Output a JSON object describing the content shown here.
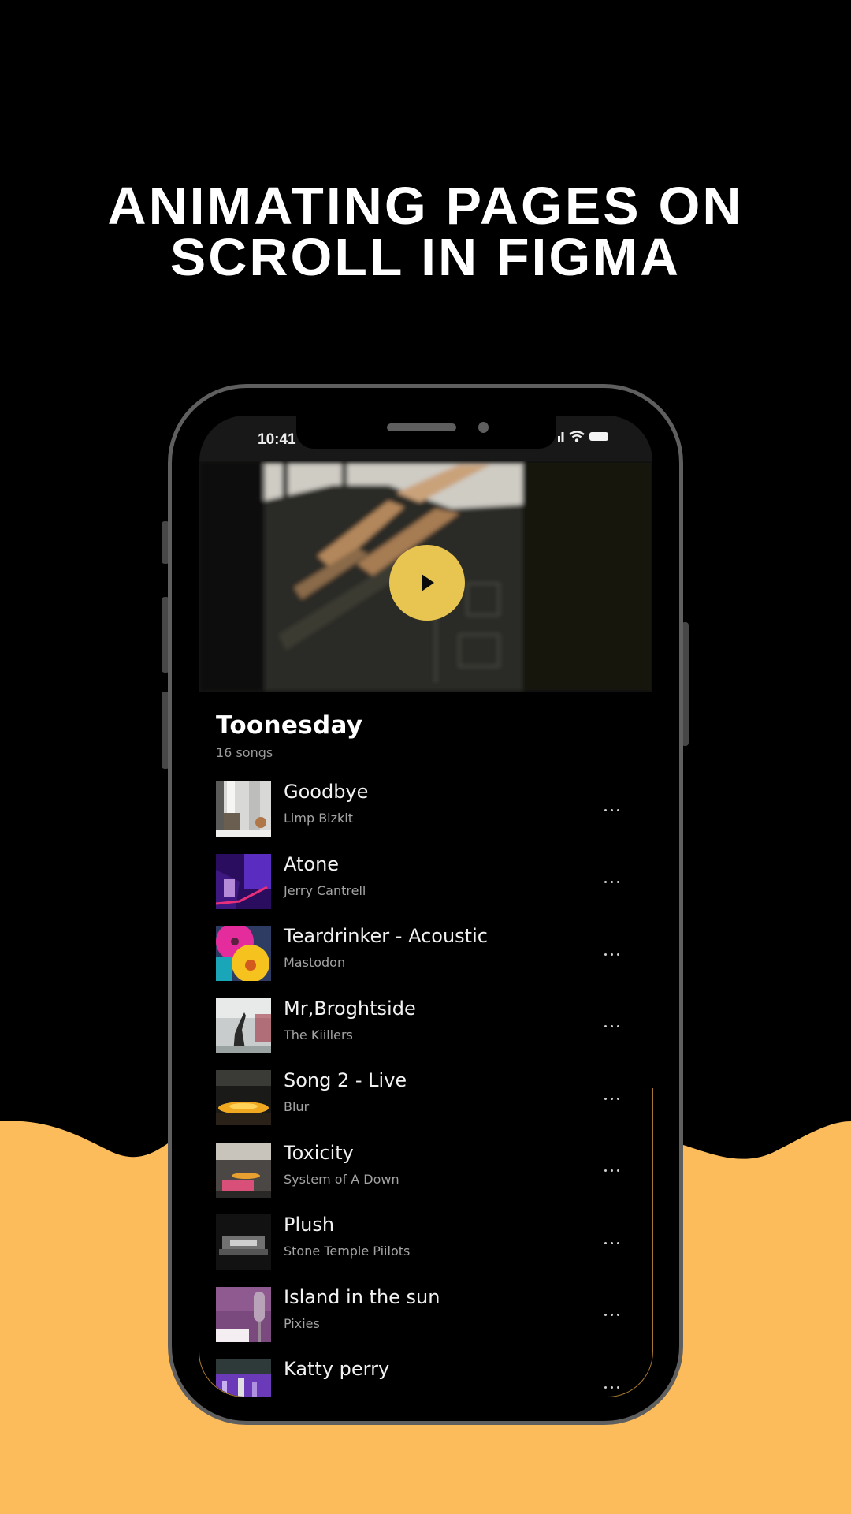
{
  "headline": {
    "line1": "ANIMATING PAGES ON",
    "line2": "SCROLL IN FIGMA"
  },
  "colors": {
    "background_top": "#000000",
    "background_wave": "#FDBC5B",
    "phone_frame": "#5F5F5F",
    "play_button": "#E8C550",
    "screen_bg": "#000000"
  },
  "status_bar": {
    "time": "10:41",
    "icons": [
      "cellular-signal-icon",
      "wifi-icon",
      "battery-icon"
    ]
  },
  "hero": {
    "media": "window blinds shadow video",
    "play_icon": "play-icon"
  },
  "playlist": {
    "title": "Toonesday",
    "count": "16 songs",
    "more_icon": "more-horizontal-icon",
    "songs": [
      {
        "title": "Goodbye",
        "artist": "Limp Bizkit",
        "art": "white-room"
      },
      {
        "title": "Atone",
        "artist": "Jerry Cantrell",
        "art": "purple-guitar"
      },
      {
        "title": "Teardrinker - Acoustic",
        "artist": "Mastodon",
        "art": "vinyl-colorful"
      },
      {
        "title": "Mr,Broghtside",
        "artist": "The Kiillers",
        "art": "smoke-concert"
      },
      {
        "title": "Song 2 - Live",
        "artist": "Blur",
        "art": "stage-lights"
      },
      {
        "title": "Toxicity",
        "artist": "System of A Down",
        "art": "record-player"
      },
      {
        "title": "Plush",
        "artist": "Stone Temple Piilots",
        "art": "dark-venue"
      },
      {
        "title": "Island in the sun",
        "artist": "Pixies",
        "art": "microphone-pink"
      },
      {
        "title": "Katty perry",
        "artist": "",
        "art": "purple-crowd"
      }
    ]
  }
}
